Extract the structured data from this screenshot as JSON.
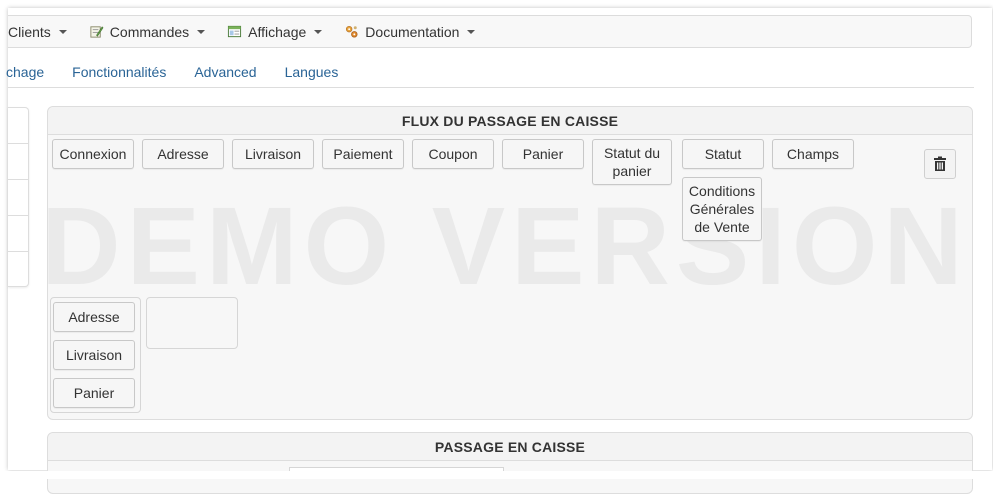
{
  "menu": {
    "items": [
      {
        "label": "Clients",
        "icon": "none"
      },
      {
        "label": "Commandes",
        "icon": "pen-paper-icon"
      },
      {
        "label": "Affichage",
        "icon": "window-icon"
      },
      {
        "label": "Documentation",
        "icon": "gears-icon"
      }
    ]
  },
  "tabs": [
    {
      "label": "chage"
    },
    {
      "label": "Fonctionnalités"
    },
    {
      "label": "Advanced"
    },
    {
      "label": "Langues"
    }
  ],
  "flux_panel": {
    "title": "FLUX DU PASSAGE EN CAISSE",
    "steps": [
      {
        "label": "Connexion"
      },
      {
        "label": "Adresse"
      },
      {
        "label": "Livraison"
      },
      {
        "label": "Paiement"
      },
      {
        "label": "Coupon"
      },
      {
        "label": "Panier"
      },
      {
        "label": "Statut du panier"
      },
      {
        "label": "Statut"
      },
      {
        "label": "Champs"
      },
      {
        "label": "Conditions Générales de Vente"
      }
    ],
    "group1": [
      "Adresse",
      "Livraison",
      "Panier"
    ]
  },
  "watermark": "DEMO VERSION",
  "panel2": {
    "title": "PASSAGE EN CAISSE"
  }
}
